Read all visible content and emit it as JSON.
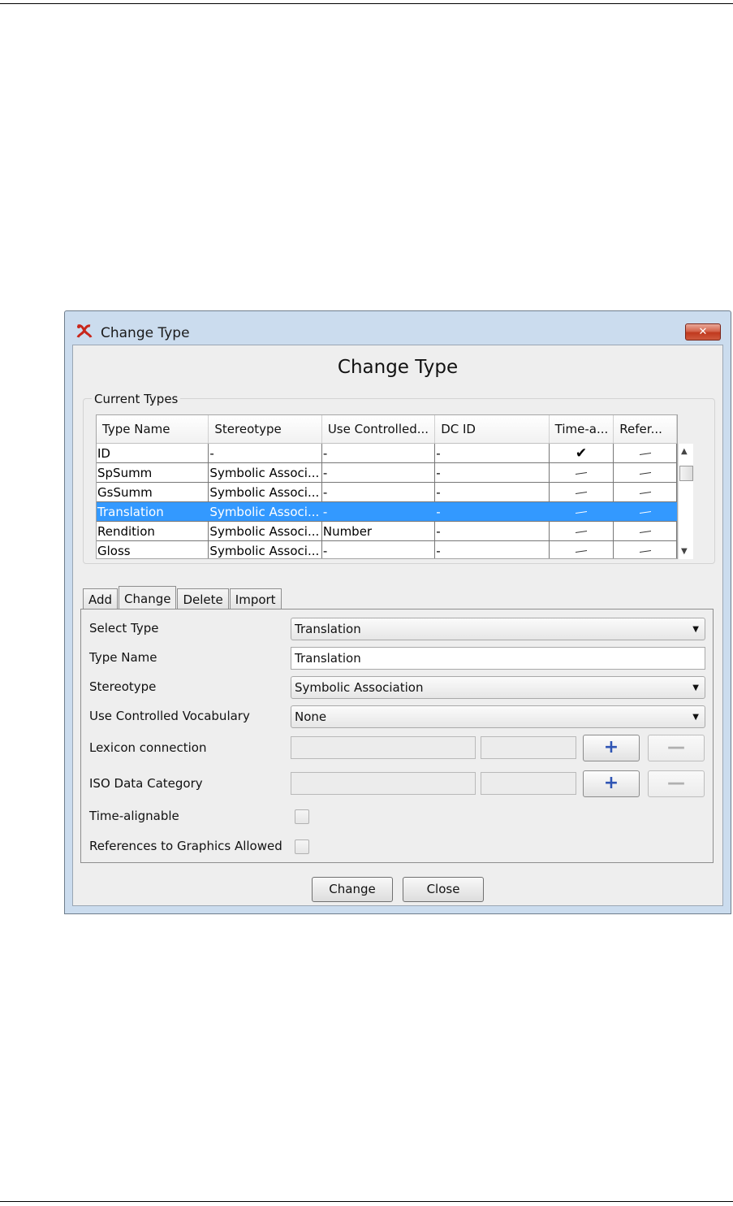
{
  "window": {
    "title": "Change Type",
    "close_label": "✕"
  },
  "dialog": {
    "heading": "Change Type"
  },
  "current_types": {
    "group_label": "Current Types",
    "columns": [
      "Type Name",
      "Stereotype",
      "Use Controlled...",
      "DC ID",
      "Time-a...",
      "Refer..."
    ],
    "rows": [
      {
        "name": "ID",
        "stereotype": "-",
        "vocab": "-",
        "dcid": "-",
        "time_alignable": true,
        "references": false,
        "selected": false
      },
      {
        "name": "SpSumm",
        "stereotype": "Symbolic Associ...",
        "vocab": "-",
        "dcid": "-",
        "time_alignable": false,
        "references": false,
        "selected": false
      },
      {
        "name": "GsSumm",
        "stereotype": "Symbolic Associ...",
        "vocab": "-",
        "dcid": "-",
        "time_alignable": false,
        "references": false,
        "selected": false
      },
      {
        "name": "Translation",
        "stereotype": "Symbolic Associ...",
        "vocab": "-",
        "dcid": "-",
        "time_alignable": false,
        "references": false,
        "selected": true
      },
      {
        "name": "Rendition",
        "stereotype": "Symbolic Associ...",
        "vocab": "Number",
        "dcid": "-",
        "time_alignable": false,
        "references": false,
        "selected": false
      },
      {
        "name": "Gloss",
        "stereotype": "Symbolic Associ...",
        "vocab": "-",
        "dcid": "-",
        "time_alignable": false,
        "references": false,
        "selected": false
      }
    ]
  },
  "tabs": [
    {
      "label": "Add",
      "active": false
    },
    {
      "label": "Change",
      "active": true
    },
    {
      "label": "Delete",
      "active": false
    },
    {
      "label": "Import",
      "active": false
    }
  ],
  "form": {
    "select_type": {
      "label": "Select Type",
      "value": "Translation"
    },
    "type_name": {
      "label": "Type Name",
      "value": "Translation"
    },
    "stereotype": {
      "label": "Stereotype",
      "value": "Symbolic Association"
    },
    "controlled_vocabulary": {
      "label": "Use Controlled Vocabulary",
      "value": "None"
    },
    "lexicon_connection": {
      "label": "Lexicon connection"
    },
    "iso_data_category": {
      "label": "ISO Data Category"
    },
    "time_alignable": {
      "label": "Time-alignable",
      "checked": false
    },
    "references_graphics": {
      "label": "References to Graphics Allowed",
      "checked": false
    },
    "plus_symbol": "+",
    "minus_symbol": "—"
  },
  "buttons": {
    "change": "Change",
    "close": "Close"
  },
  "marks": {
    "check": "✔"
  },
  "icons": {
    "app": "elan-logo-icon",
    "dropdown": "dropdown-arrow-icon"
  },
  "colors": {
    "selection": "#3399ff",
    "close_button": "#c7452b",
    "window_frame": "#cbdcee"
  }
}
